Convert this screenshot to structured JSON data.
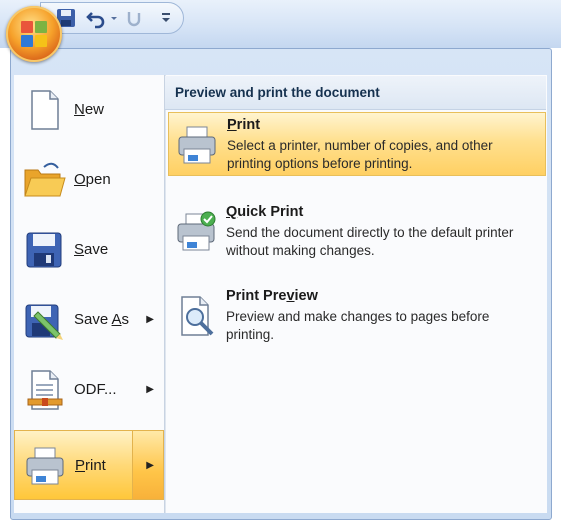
{
  "quick_access": {
    "icons": [
      "save-icon",
      "undo-icon",
      "redo-icon",
      "customize-toolbar-icon"
    ]
  },
  "menu": {
    "left_items": [
      {
        "id": "new",
        "label": "New",
        "underline": "N",
        "has_submenu": false,
        "icon": "new-document-icon"
      },
      {
        "id": "open",
        "label": "Open",
        "underline": "O",
        "has_submenu": false,
        "icon": "folder-open-icon"
      },
      {
        "id": "save",
        "label": "Save",
        "underline": "S",
        "has_submenu": false,
        "icon": "floppy-disk-icon"
      },
      {
        "id": "save-as",
        "label": "Save As",
        "underline": "A",
        "has_submenu": true,
        "icon": "save-as-icon"
      },
      {
        "id": "odf",
        "label": "ODF...",
        "underline": "",
        "has_submenu": true,
        "icon": "odf-document-icon"
      },
      {
        "id": "print",
        "label": "Print",
        "underline": "P",
        "has_submenu": true,
        "selected": true,
        "icon": "printer-icon"
      }
    ],
    "submenu_title": "Preview and print the document",
    "commands": [
      {
        "id": "print",
        "title": "Print",
        "underline": "P",
        "description": "Select a printer, number of copies, and other printing options before printing.",
        "highlighted": true,
        "icon": "printer-icon"
      },
      {
        "id": "quick-print",
        "title": "Quick Print",
        "underline": "Q",
        "description": "Send the document directly to the default printer without making changes.",
        "highlighted": false,
        "icon": "quick-print-icon"
      },
      {
        "id": "print-preview",
        "title": "Print Preview",
        "underline": "v",
        "description": "Preview and make changes to pages before printing.",
        "highlighted": false,
        "icon": "print-preview-icon"
      }
    ]
  },
  "colors": {
    "highlight": "#ffd978",
    "title_bar": "#d6e4f6",
    "office_button": "#f6a12a"
  }
}
